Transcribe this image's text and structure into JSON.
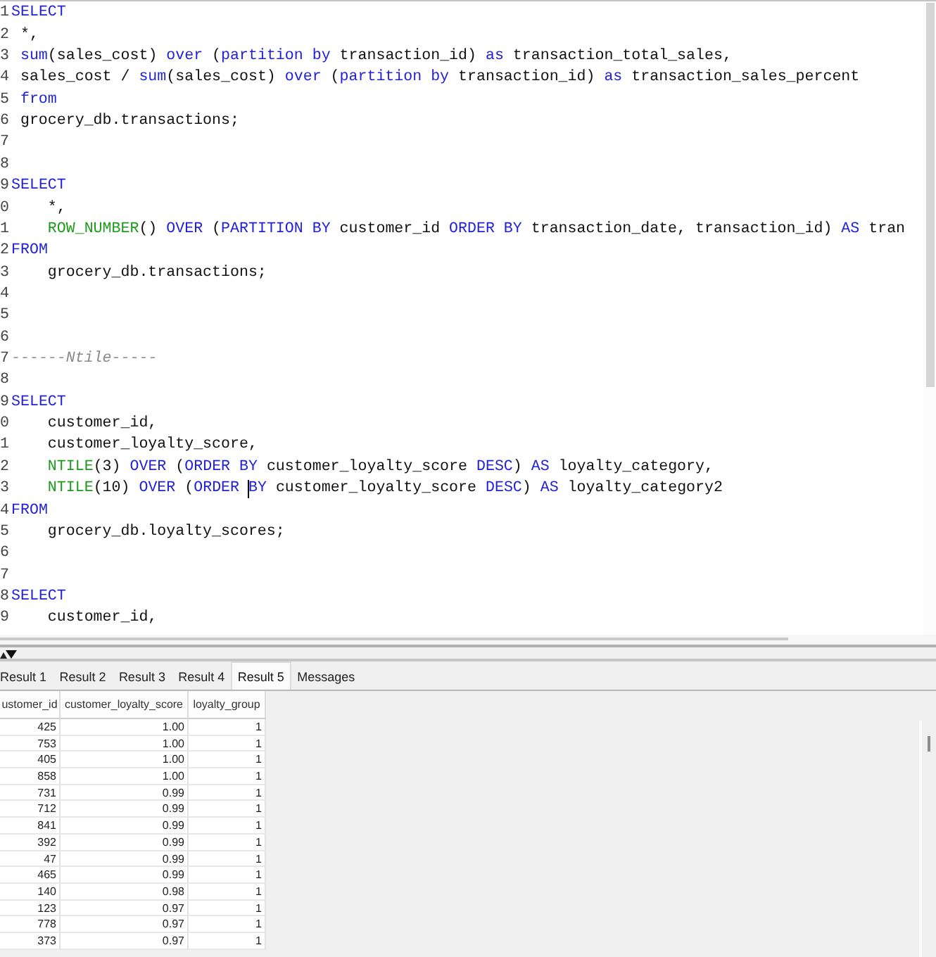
{
  "editor": {
    "lines": [
      {
        "number": "1",
        "kind": "flush",
        "tokens": [
          {
            "text": "SELECT",
            "kind": "keyword"
          }
        ]
      },
      {
        "number": "2",
        "kind": "shallow",
        "tokens": [
          {
            "text": "*,",
            "kind": "plain"
          }
        ]
      },
      {
        "number": "3",
        "kind": "shallow",
        "tokens": [
          {
            "text": "sum",
            "kind": "keyword"
          },
          {
            "text": "(sales_cost) ",
            "kind": "plain"
          },
          {
            "text": "over",
            "kind": "keyword"
          },
          {
            "text": " (",
            "kind": "plain"
          },
          {
            "text": "partition by",
            "kind": "keyword"
          },
          {
            "text": " transaction_id) ",
            "kind": "plain"
          },
          {
            "text": "as",
            "kind": "keyword"
          },
          {
            "text": " transaction_total_sales,",
            "kind": "plain"
          }
        ]
      },
      {
        "number": "4",
        "kind": "shallow",
        "tokens": [
          {
            "text": "sales_cost / ",
            "kind": "plain"
          },
          {
            "text": "sum",
            "kind": "keyword"
          },
          {
            "text": "(sales_cost) ",
            "kind": "plain"
          },
          {
            "text": "over",
            "kind": "keyword"
          },
          {
            "text": " (",
            "kind": "plain"
          },
          {
            "text": "partition by",
            "kind": "keyword"
          },
          {
            "text": " transaction_id) ",
            "kind": "plain"
          },
          {
            "text": "as",
            "kind": "keyword"
          },
          {
            "text": " transaction_sales_percent",
            "kind": "plain"
          }
        ]
      },
      {
        "number": "5",
        "kind": "shallow",
        "tokens": [
          {
            "text": "from",
            "kind": "keyword"
          }
        ]
      },
      {
        "number": "6",
        "kind": "shallow",
        "tokens": [
          {
            "text": "grocery_db.transactions;",
            "kind": "plain"
          }
        ]
      },
      {
        "number": "7",
        "kind": "blank"
      },
      {
        "number": "8",
        "kind": "blank"
      },
      {
        "number": "9",
        "kind": "flush",
        "tokens": [
          {
            "text": "SELECT",
            "kind": "keyword"
          }
        ]
      },
      {
        "number": "0",
        "kind": "deep",
        "tokens": [
          {
            "text": "*,",
            "kind": "plain"
          }
        ]
      },
      {
        "number": "1",
        "kind": "deep",
        "tokens": [
          {
            "text": "ROW_NUMBER",
            "kind": "function"
          },
          {
            "text": "() ",
            "kind": "plain"
          },
          {
            "text": "OVER",
            "kind": "keyword"
          },
          {
            "text": " (",
            "kind": "plain"
          },
          {
            "text": "PARTITION BY",
            "kind": "keyword"
          },
          {
            "text": " customer_id ",
            "kind": "plain"
          },
          {
            "text": "ORDER BY",
            "kind": "keyword"
          },
          {
            "text": " transaction_date, transaction_id) ",
            "kind": "plain"
          },
          {
            "text": "AS",
            "kind": "keyword"
          },
          {
            "text": " tran",
            "kind": "plain"
          }
        ]
      },
      {
        "number": "2",
        "kind": "flush",
        "tokens": [
          {
            "text": "FROM",
            "kind": "keyword"
          }
        ]
      },
      {
        "number": "3",
        "kind": "deep",
        "tokens": [
          {
            "text": "grocery_db.transactions;",
            "kind": "plain"
          }
        ]
      },
      {
        "number": "4",
        "kind": "blank"
      },
      {
        "number": "5",
        "kind": "blank"
      },
      {
        "number": "6",
        "kind": "blank"
      },
      {
        "number": "7",
        "kind": "flush",
        "tokens": [
          {
            "text": "------Ntile-----",
            "kind": "comment"
          }
        ]
      },
      {
        "number": "8",
        "kind": "blank"
      },
      {
        "number": "9",
        "kind": "flush",
        "tokens": [
          {
            "text": "SELECT",
            "kind": "keyword"
          }
        ]
      },
      {
        "number": "0",
        "kind": "deep",
        "tokens": [
          {
            "text": "customer_id,",
            "kind": "plain"
          }
        ]
      },
      {
        "number": "1",
        "kind": "deep",
        "tokens": [
          {
            "text": "customer_loyalty_score,",
            "kind": "plain"
          }
        ]
      },
      {
        "number": "2",
        "kind": "deep",
        "tokens": [
          {
            "text": "NTILE",
            "kind": "function"
          },
          {
            "text": "(3) ",
            "kind": "plain"
          },
          {
            "text": "OVER",
            "kind": "keyword"
          },
          {
            "text": " (",
            "kind": "plain"
          },
          {
            "text": "ORDER BY",
            "kind": "keyword"
          },
          {
            "text": " customer_loyalty_score ",
            "kind": "plain"
          },
          {
            "text": "DESC",
            "kind": "keyword"
          },
          {
            "text": ") ",
            "kind": "plain"
          },
          {
            "text": "AS",
            "kind": "keyword"
          },
          {
            "text": " loyalty_category,",
            "kind": "plain"
          }
        ]
      },
      {
        "number": "3",
        "kind": "deep",
        "tokens": [
          {
            "text": "NTILE",
            "kind": "function"
          },
          {
            "text": "(10) ",
            "kind": "plain"
          },
          {
            "text": "OVER",
            "kind": "keyword"
          },
          {
            "text": " (",
            "kind": "plain"
          },
          {
            "text": "ORDER ",
            "kind": "keyword"
          },
          {
            "text": "BY",
            "kind": "keyword",
            "cursor_before": true
          },
          {
            "text": " customer_loyalty_score ",
            "kind": "plain"
          },
          {
            "text": "DESC",
            "kind": "keyword"
          },
          {
            "text": ") ",
            "kind": "plain"
          },
          {
            "text": "AS",
            "kind": "keyword"
          },
          {
            "text": " loyalty_category2",
            "kind": "plain"
          }
        ]
      },
      {
        "number": "4",
        "kind": "flush",
        "tokens": [
          {
            "text": "FROM",
            "kind": "keyword"
          }
        ]
      },
      {
        "number": "5",
        "kind": "deep",
        "tokens": [
          {
            "text": "grocery_db.loyalty_scores;",
            "kind": "plain"
          }
        ]
      },
      {
        "number": "6",
        "kind": "blank"
      },
      {
        "number": "7",
        "kind": "blank"
      },
      {
        "number": "8",
        "kind": "flush",
        "tokens": [
          {
            "text": "SELECT",
            "kind": "keyword"
          }
        ]
      },
      {
        "number": "9",
        "kind": "deep",
        "tokens": [
          {
            "text": "customer_id,",
            "kind": "plain"
          }
        ]
      }
    ]
  },
  "results": {
    "tabs": [
      {
        "label": "Result 1",
        "selected": false
      },
      {
        "label": "Result 2",
        "selected": false
      },
      {
        "label": "Result 3",
        "selected": false
      },
      {
        "label": "Result 4",
        "selected": false
      },
      {
        "label": "Result 5",
        "selected": true
      },
      {
        "label": "Messages",
        "selected": false
      }
    ],
    "grid": {
      "columns": [
        "ustomer_id",
        "customer_loyalty_score",
        "loyalty_group"
      ],
      "rows": [
        [
          "425",
          "1.00",
          "1"
        ],
        [
          "753",
          "1.00",
          "1"
        ],
        [
          "405",
          "1.00",
          "1"
        ],
        [
          "858",
          "1.00",
          "1"
        ],
        [
          "731",
          "0.99",
          "1"
        ],
        [
          "712",
          "0.99",
          "1"
        ],
        [
          "841",
          "0.99",
          "1"
        ],
        [
          "392",
          "0.99",
          "1"
        ],
        [
          "47",
          "0.99",
          "1"
        ],
        [
          "465",
          "0.99",
          "1"
        ],
        [
          "140",
          "0.98",
          "1"
        ],
        [
          "123",
          "0.97",
          "1"
        ],
        [
          "778",
          "0.97",
          "1"
        ],
        [
          "373",
          "0.97",
          "1"
        ]
      ]
    }
  }
}
